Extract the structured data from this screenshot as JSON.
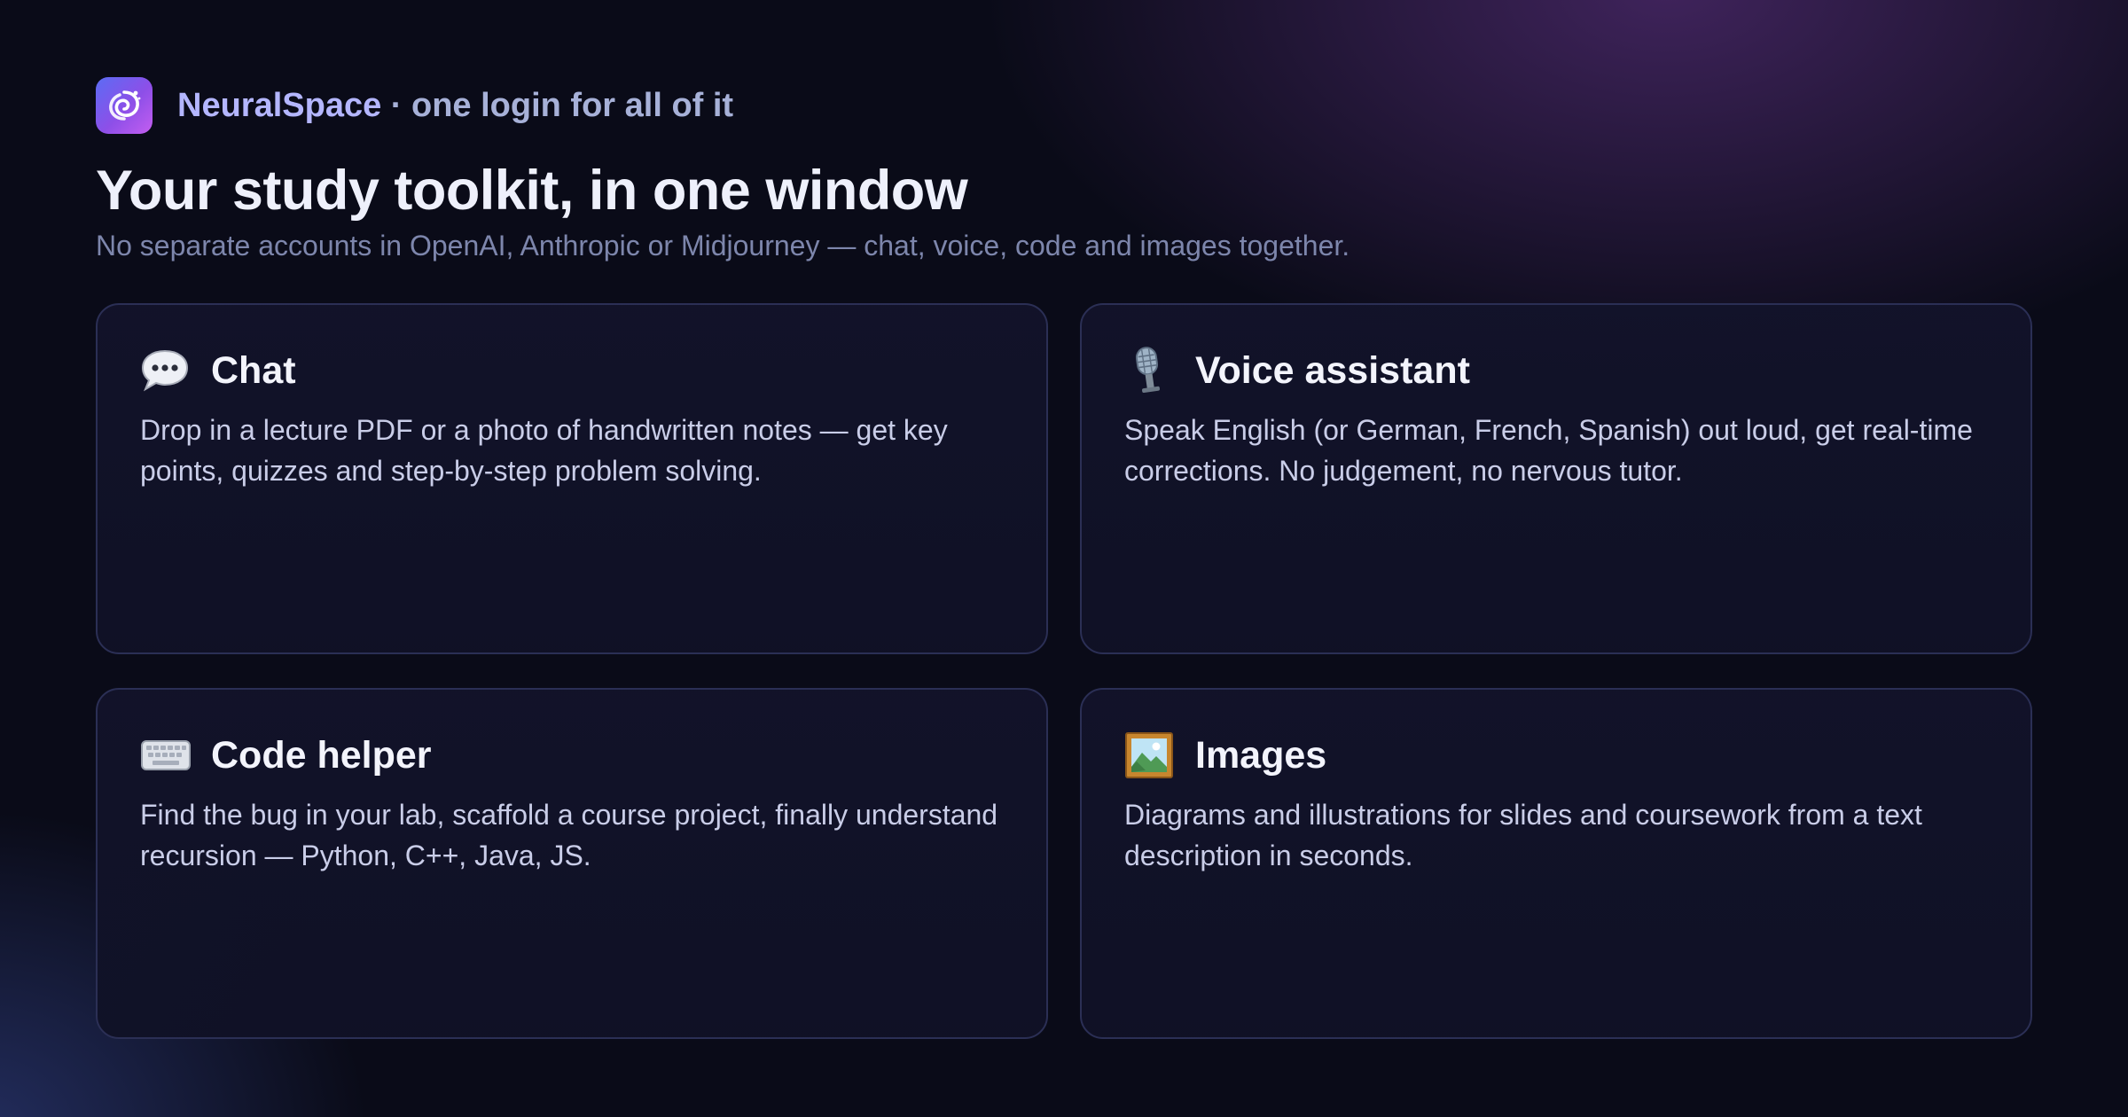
{
  "brand": {
    "name": "NeuralSpace",
    "tagline": " · one login for all of it",
    "logo_icon": "swirl-galaxy-icon"
  },
  "hero": {
    "title": "Your study toolkit, in one window",
    "subtitle": "No separate accounts in OpenAI, Anthropic or Midjourney — chat, voice, code and images together."
  },
  "features": [
    {
      "icon": "speech-bubble-icon",
      "title": "Chat",
      "description": "Drop in a lecture PDF or a photo of handwritten notes — get key points, quizzes and step-by-step problem solving."
    },
    {
      "icon": "microphone-icon",
      "title": "Voice assistant",
      "description": "Speak English (or German, French, Spanish) out loud, get real-time corrections. No judgement, no nervous tutor."
    },
    {
      "icon": "keyboard-icon",
      "title": "Code helper",
      "description": "Find the bug in your lab, scaffold a course project, finally understand recursion — Python, C++, Java, JS."
    },
    {
      "icon": "framed-picture-icon",
      "title": "Images",
      "description": "Diagrams and illustrations for slides and coursework from a text description in seconds."
    }
  ],
  "colors": {
    "background": "#0a0b18",
    "brand_accent": "#b4b6ff",
    "card_border": "#2b2f55",
    "logo_gradient": [
      "#5b6cf4",
      "#c45ef0"
    ]
  }
}
